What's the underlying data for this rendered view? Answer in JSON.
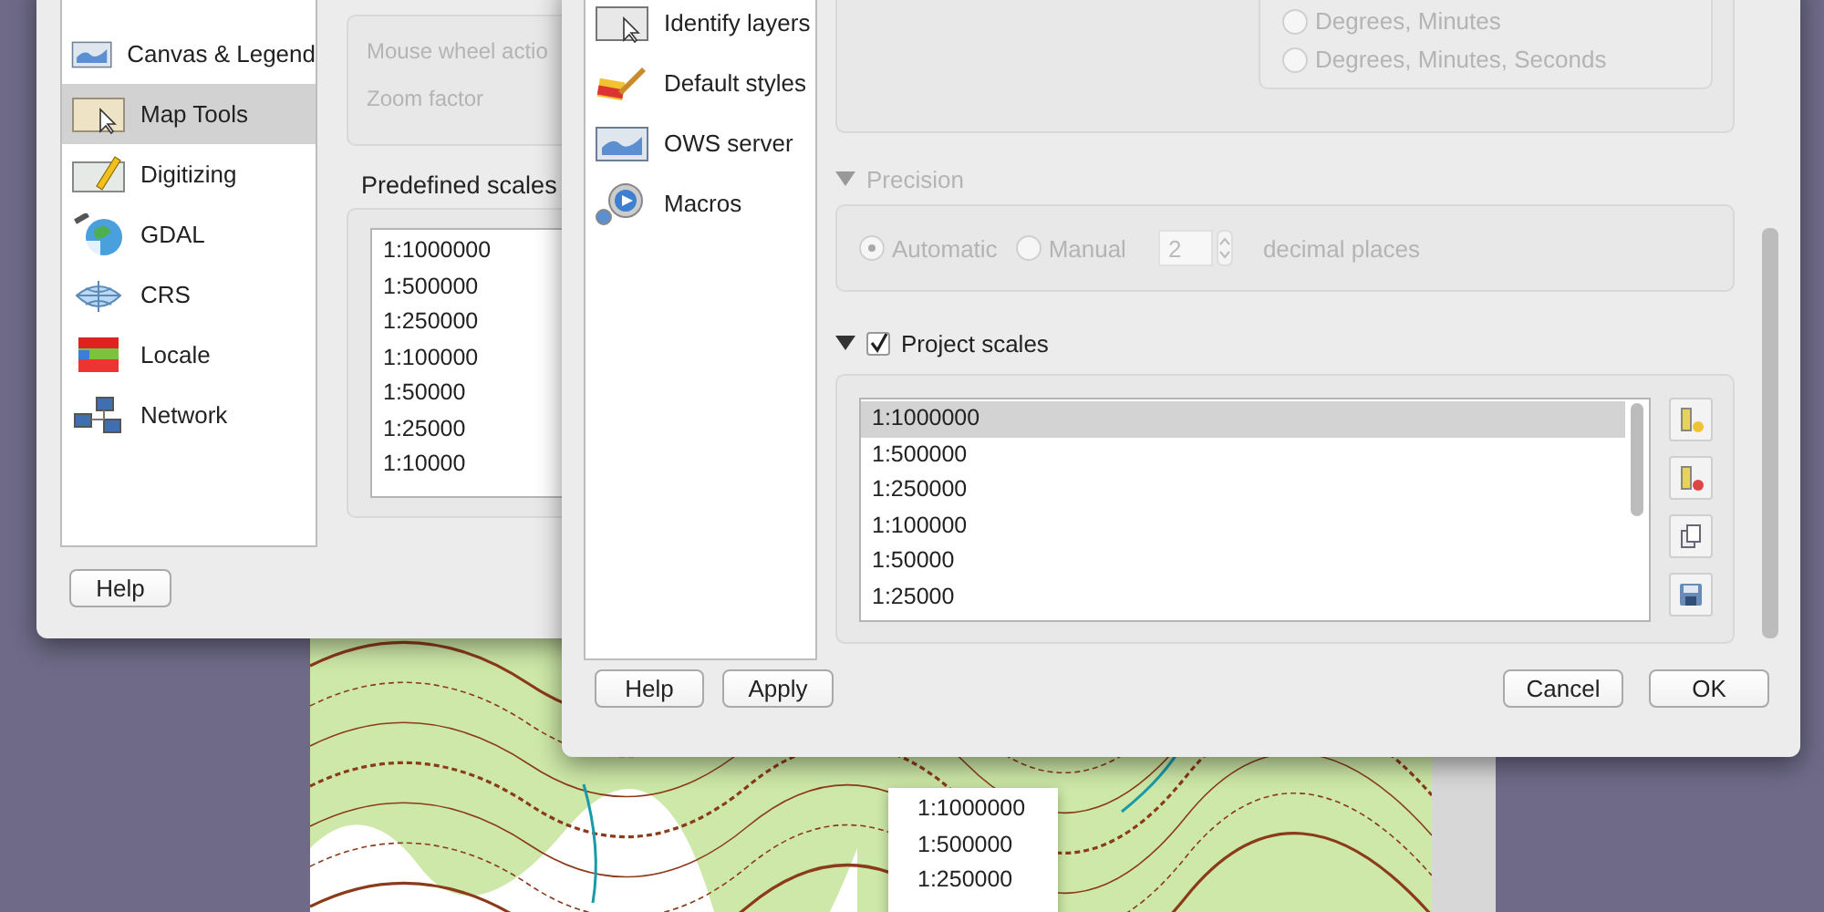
{
  "map_window": {
    "scale_dropdown": {
      "items": [
        {
          "label": "1:1000000",
          "selected": false
        },
        {
          "label": "1:500000",
          "selected": false
        },
        {
          "label": "1:250000",
          "selected": false
        }
      ]
    }
  },
  "back_dialog": {
    "sidebar": {
      "items": [
        {
          "label": "Canvas & Legend",
          "selected": false
        },
        {
          "label": "Map Tools",
          "selected": true
        },
        {
          "label": "Digitizing",
          "selected": false
        },
        {
          "label": "GDAL",
          "selected": false
        },
        {
          "label": "CRS",
          "selected": false
        },
        {
          "label": "Locale",
          "selected": false
        },
        {
          "label": "Network",
          "selected": false
        }
      ]
    },
    "panning_group": {
      "disabled": true,
      "labels": [
        "Mouse wheel actio",
        "Zoom factor"
      ]
    },
    "predefined_scales": {
      "title": "Predefined scales",
      "items": [
        {
          "label": "1:1000000",
          "selected": false
        },
        {
          "label": "1:500000",
          "selected": false
        },
        {
          "label": "1:250000",
          "selected": false
        },
        {
          "label": "1:100000",
          "selected": false
        },
        {
          "label": "1:50000",
          "selected": false
        },
        {
          "label": "1:25000",
          "selected": false
        },
        {
          "label": "1:10000",
          "selected": false
        }
      ]
    },
    "buttons": [
      "Help"
    ]
  },
  "front_dialog": {
    "sidebar": {
      "items": [
        {
          "label": "Identify layers",
          "selected": false
        },
        {
          "label": "Default styles",
          "selected": false
        },
        {
          "label": "OWS server",
          "selected": false
        },
        {
          "label": "Macros",
          "selected": false
        }
      ]
    },
    "coordinate_format": {
      "disabled": true,
      "options": [
        {
          "label": "Degrees, Minutes",
          "selected": false
        },
        {
          "label": "Degrees, Minutes, Seconds",
          "selected": false
        }
      ]
    },
    "precision": {
      "title": "Precision",
      "expanded": true,
      "disabled": true,
      "options": [
        {
          "label": "Automatic",
          "selected": true
        },
        {
          "label": "Manual",
          "selected": false
        }
      ],
      "decimals": "2",
      "decimals_label": "decimal places"
    },
    "project_scales": {
      "title": "Project scales",
      "expanded": true,
      "checked": true,
      "items": [
        {
          "label": "1:1000000",
          "selected": true
        },
        {
          "label": "1:500000",
          "selected": false
        },
        {
          "label": "1:250000",
          "selected": false
        },
        {
          "label": "1:100000",
          "selected": false
        },
        {
          "label": "1:50000",
          "selected": false
        },
        {
          "label": "1:25000",
          "selected": false
        }
      ]
    },
    "buttons_left": [
      "Help",
      "Apply"
    ],
    "buttons_right": [
      "Cancel",
      "OK"
    ]
  }
}
